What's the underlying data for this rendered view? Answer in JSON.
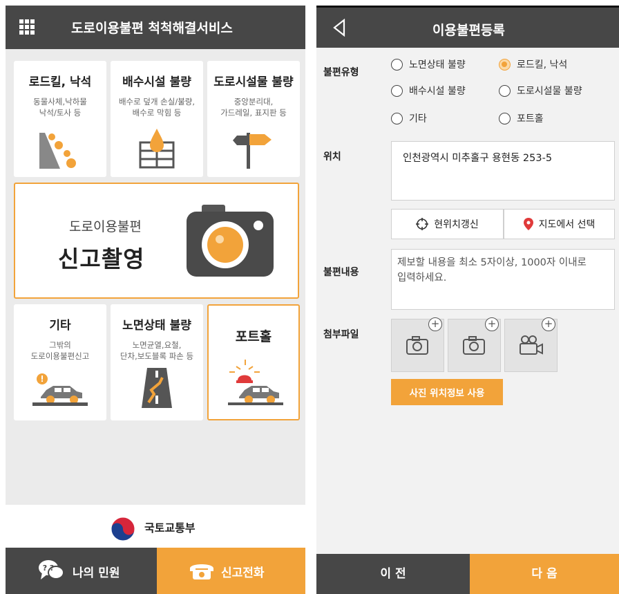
{
  "left": {
    "header_title": "도로이용불편 척척해결서비스",
    "tiles": [
      {
        "title": "로드킬, 낙석",
        "sub": "동물사체,낙하물\n낙석/토사 등"
      },
      {
        "title": "배수시설 불량",
        "sub": "배수로 덮개 손실/불량,\n배수로 막힘 등"
      },
      {
        "title": "도로시설물 불량",
        "sub": "중앙분리대,\n가드레일, 표지판 등"
      },
      {
        "title": "기타",
        "sub": "그밖의\n도로이용불편신고"
      },
      {
        "title": "노면상태 불량",
        "sub": "노면균열,요철,\n단차,보도블록 파손 등"
      },
      {
        "title": "포트홀",
        "sub": ""
      }
    ],
    "report_sub": "도로이용불편",
    "report_main": "신고촬영",
    "ministry": "국토교통부",
    "footer": {
      "my_complaints": "나의 민원",
      "report_call": "신고전화"
    }
  },
  "right": {
    "header_title": "이용불편등록",
    "type_label": "불편유형",
    "types": [
      "노면상태 불량",
      "로드킬, 낙석",
      "배수시설 불량",
      "도로시설물 불량",
      "기타",
      "포트홀"
    ],
    "selected_type": "로드킬, 낙석",
    "location_label": "위치",
    "location_value": "인천광역시 미추홀구 용현동 253-5",
    "refresh_location": "현위치갱신",
    "select_on_map": "지도에서 선택",
    "content_label": "불편내용",
    "content_placeholder": "제보할 내용을 최소 5자이상, 1000자 이내로 입력하세요.",
    "attach_label": "첨부파일",
    "use_photo_location": "사진 위치정보 사용",
    "prev": "이 전",
    "next": "다 음"
  },
  "colors": {
    "accent": "#f2a33a",
    "header": "#474747"
  }
}
